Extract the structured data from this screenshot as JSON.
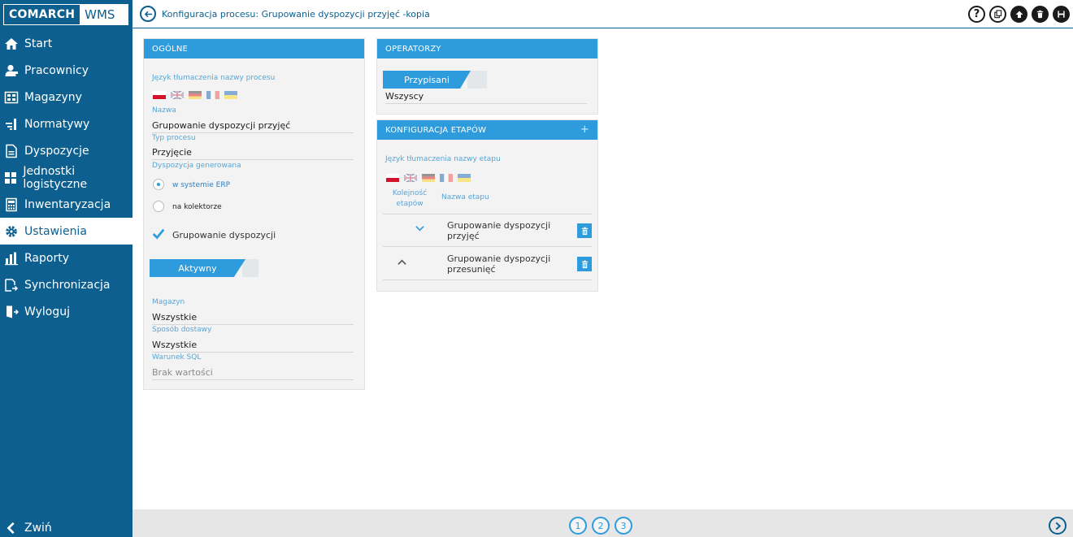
{
  "logo": {
    "part1": "COMARCH",
    "part2": "WMS"
  },
  "sidebar": {
    "items": [
      {
        "label": "Start",
        "icon": "home-icon",
        "active": false
      },
      {
        "label": "Pracownicy",
        "icon": "users-icon",
        "active": false
      },
      {
        "label": "Magazyny",
        "icon": "warehouse-icon",
        "active": false
      },
      {
        "label": "Normatywy",
        "icon": "norms-icon",
        "active": false
      },
      {
        "label": "Dyspozycje",
        "icon": "document-icon",
        "active": false
      },
      {
        "label": "Jednostki logistyczne",
        "icon": "grid-icon",
        "active": false
      },
      {
        "label": "Inwentaryzacja",
        "icon": "calculator-icon",
        "active": false
      },
      {
        "label": "Ustawienia",
        "icon": "gear-icon",
        "active": true
      },
      {
        "label": "Raporty",
        "icon": "bar-chart-icon",
        "active": false
      },
      {
        "label": "Synchronizacja",
        "icon": "sync-icon",
        "active": false
      },
      {
        "label": "Wyloguj",
        "icon": "logout-icon",
        "active": false
      }
    ],
    "collapse_label": "Zwiń"
  },
  "header": {
    "title": "Konfiguracja procesu: Grupowanie dyspozycji przyjęć -kopia",
    "actions": [
      "help-icon",
      "copy-icon",
      "upload-icon",
      "delete-icon",
      "save-icon"
    ]
  },
  "general": {
    "heading": "OGÓLNE",
    "lang_label": "Język tłumaczenia nazwy procesu",
    "name_label": "Nazwa",
    "name_value": "Grupowanie dyspozycji przyjęć",
    "type_label": "Typ procesu",
    "type_value": "Przyjęcie",
    "generated_label": "Dyspozycja generowana",
    "radio_erp": "w systemie ERP",
    "radio_collector": "na kolektorze",
    "grouping_label": "Grupowanie dyspozycji",
    "status_tag": "Aktywny",
    "warehouse_label": "Magazyn",
    "warehouse_value": "Wszystkie",
    "delivery_label": "Sposób dostawy",
    "delivery_value": "Wszystkie",
    "sql_label": "Warunek SQL",
    "sql_value": "Brak wartości"
  },
  "operators": {
    "heading": "OPERATORZY",
    "tag": "Przypisani",
    "value": "Wszyscy"
  },
  "stages": {
    "heading": "KONFIGURACJA ETAPÓW",
    "plus": "+",
    "lang_label": "Język tłumaczenia nazwy etapu",
    "col_order_line1": "Kolejność",
    "col_order_line2": "etapów",
    "col_name": "Nazwa etapu",
    "rows": [
      {
        "line1": "Grupowanie dyspozycji",
        "line2": "przyjęć",
        "chevron": "⌄"
      },
      {
        "line1": "Grupowanie dyspozycji",
        "line2": "przesunięć",
        "chevron": "⌃"
      }
    ]
  },
  "footer": {
    "pages": [
      "1",
      "2",
      "3"
    ]
  },
  "colors": {
    "sidebar": "#0c5f8f",
    "accent": "#2d9bdc",
    "label": "#58a5d6"
  }
}
